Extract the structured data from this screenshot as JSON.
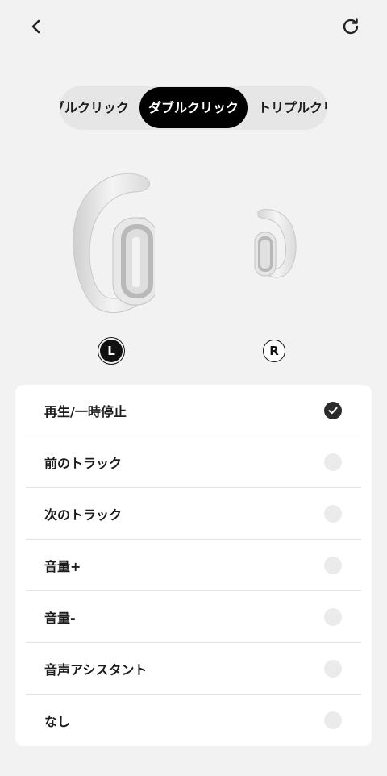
{
  "header": {
    "back_icon": "chevron-left-icon",
    "reset_icon": "refresh-icon"
  },
  "tabs": [
    {
      "label": "シングルクリック",
      "visible_text": "ブルクリック",
      "active": false
    },
    {
      "label": "ダブルクリック",
      "active": true
    },
    {
      "label": "トリプルクリック",
      "visible_text": "トリプルクリ",
      "active": false
    }
  ],
  "earbuds": {
    "left_badge": "L",
    "right_badge": "R",
    "selected": "L"
  },
  "options": [
    {
      "label": "再生/一時停止",
      "checked": true
    },
    {
      "label": "前のトラック",
      "checked": false
    },
    {
      "label": "次のトラック",
      "checked": false
    },
    {
      "label": "音量+",
      "checked": false
    },
    {
      "label": "音量-",
      "checked": false
    },
    {
      "label": "音声アシスタント",
      "checked": false
    },
    {
      "label": "なし",
      "checked": false
    }
  ],
  "colors": {
    "background": "#f2f2f2",
    "active_tab": "#000000",
    "check": "#2b2b2b"
  }
}
